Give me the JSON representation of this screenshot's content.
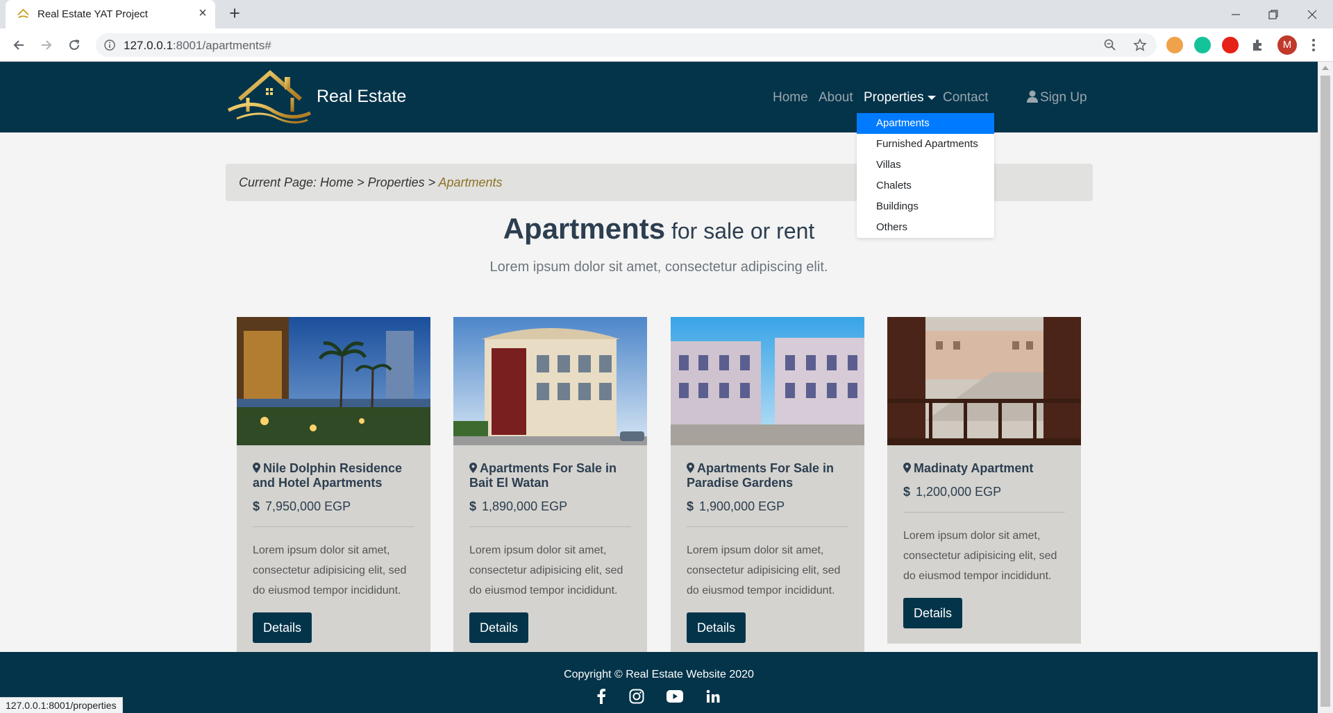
{
  "browser": {
    "tab_title": "Real Estate YAT Project",
    "url_host": "127.0.0.1",
    "url_rest": ":8001/apartments#",
    "profile_initial": "M",
    "status_url": "127.0.0.1:8001/properties"
  },
  "header": {
    "brand": "Real Estate",
    "nav": {
      "home": "Home",
      "about": "About",
      "properties": "Properties",
      "contact": "Contact",
      "signup": "Sign Up"
    },
    "dropdown": [
      "Apartments",
      "Furnished Apartments",
      "Villas",
      "Chalets",
      "Buildings",
      "Others"
    ]
  },
  "breadcrumb": {
    "prefix": "Current Page: Home > Properties > ",
    "current": "Apartments"
  },
  "main": {
    "title_bold": "Apartments",
    "title_rest": " for sale or rent",
    "lead": "Lorem ipsum dolor sit amet, consectetur adipiscing elit."
  },
  "cards": [
    {
      "title": "Nile Dolphin Residence and Hotel Apartments",
      "price": "7,950,000 EGP",
      "desc": "Lorem ipsum dolor sit amet, consectetur adipisicing elit, sed do eiusmod tempor incididunt.",
      "button": "Details"
    },
    {
      "title": "Apartments For Sale in Bait El Watan",
      "price": "1,890,000 EGP",
      "desc": "Lorem ipsum dolor sit amet, consectetur adipisicing elit, sed do eiusmod tempor incididunt.",
      "button": "Details"
    },
    {
      "title": "Apartments For Sale in Paradise Gardens",
      "price": "1,900,000 EGP",
      "desc": "Lorem ipsum dolor sit amet, consectetur adipisicing elit, sed do eiusmod tempor incididunt.",
      "button": "Details"
    },
    {
      "title": "Madinaty Apartment",
      "price": "1,200,000 EGP",
      "desc": "Lorem ipsum dolor sit amet, consectetur adipisicing elit, sed do eiusmod tempor incididunt.",
      "button": "Details"
    }
  ],
  "footer": {
    "copyright": "Copyright © Real Estate Website 2020",
    "social": [
      "facebook-icon",
      "instagram-icon",
      "youtube-icon",
      "linkedin-icon"
    ]
  },
  "colors": {
    "header_bg": "#04344a",
    "dropdown_active": "#007bff",
    "card_bg": "#d4d3cf",
    "breadcrumb_current": "#8c7126"
  }
}
